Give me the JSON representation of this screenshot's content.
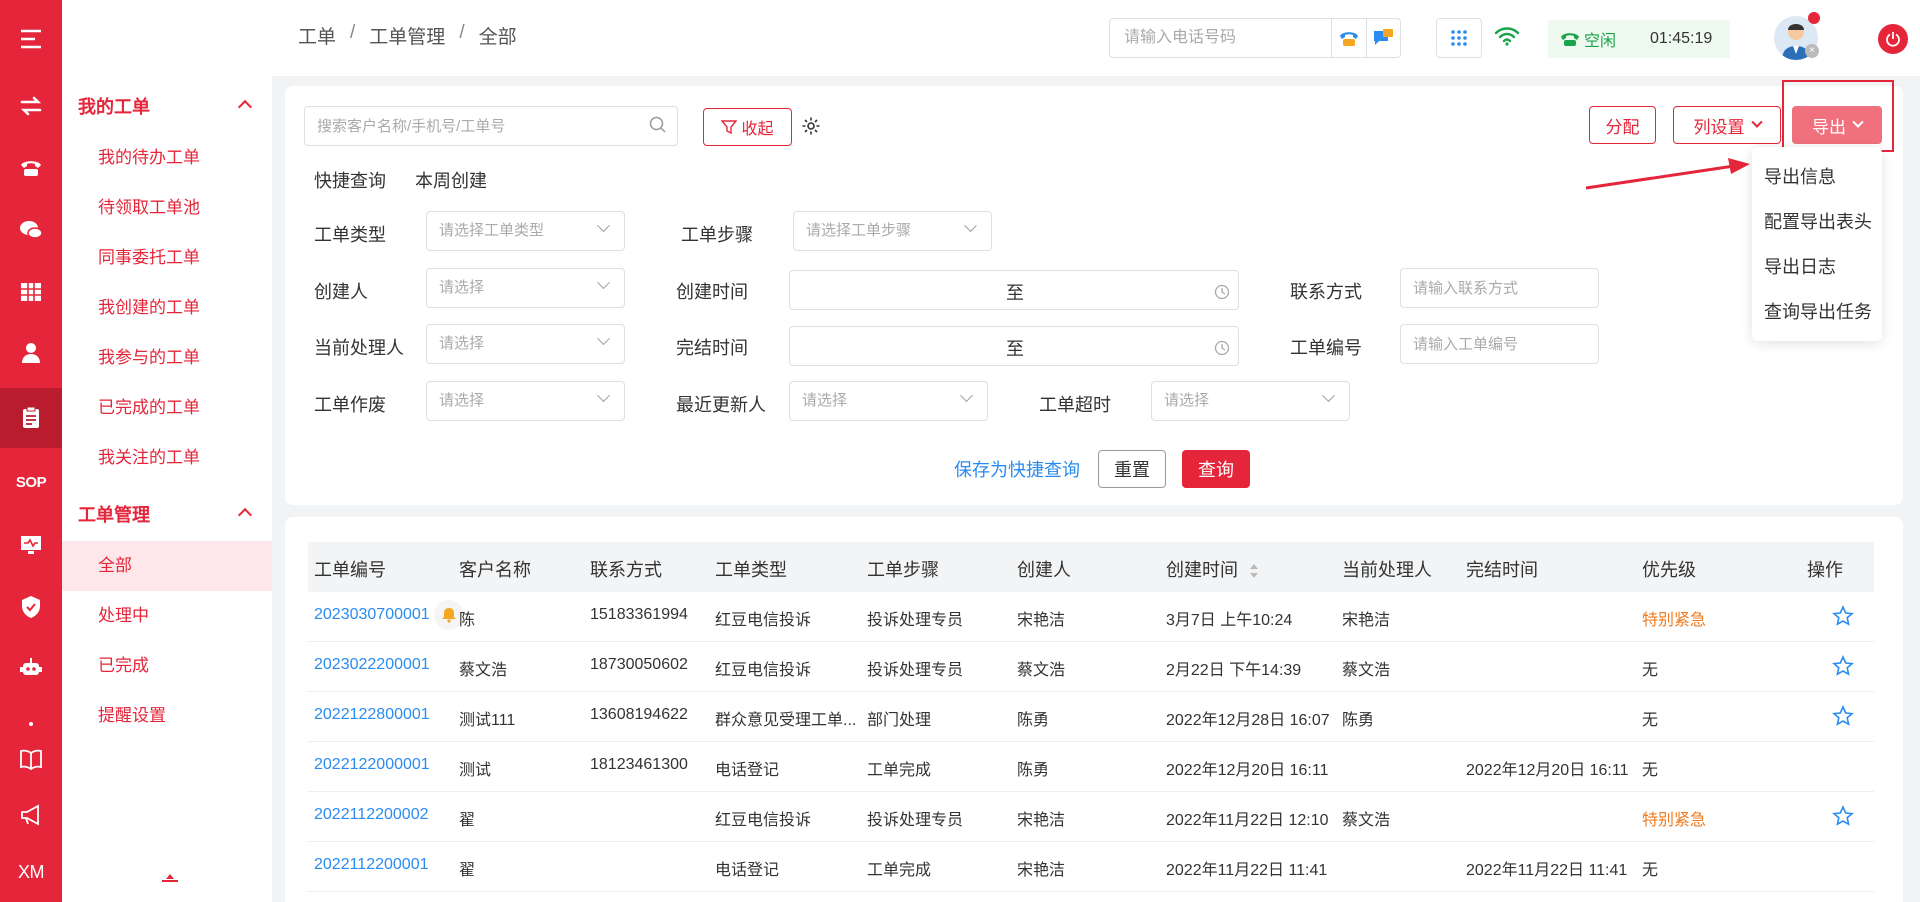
{
  "colors": {
    "brand": "#e5263a",
    "link": "#2a8cf0",
    "urgent": "#f07a1e",
    "status_green": "#1aa34a"
  },
  "rail": {
    "icons": [
      "menu-icon",
      "transfer-icon",
      "phone-icon",
      "chat-icon",
      "grid-icon",
      "user-icon",
      "clipboard-icon",
      "sop-label",
      "monitor-icon",
      "shield-icon",
      "robot-icon",
      "dot-icon",
      "book-icon",
      "megaphone-icon",
      "xm-label"
    ],
    "sop": "SOP",
    "xm": "XM"
  },
  "sidebar": {
    "group1": {
      "title": "我的工单",
      "items": [
        "我的待办工单",
        "待领取工单池",
        "同事委托工单",
        "我创建的工单",
        "我参与的工单",
        "已完成的工单",
        "我关注的工单"
      ]
    },
    "group2": {
      "title": "工单管理",
      "items": [
        "全部",
        "处理中",
        "已完成",
        "提醒设置"
      ]
    }
  },
  "header": {
    "breadcrumb": [
      "工单",
      "工单管理",
      "全部"
    ],
    "phone_placeholder": "请输入电话号码",
    "status": "空闲",
    "time": "01:45:19"
  },
  "filters": {
    "search_placeholder": "搜索客户名称/手机号/工单号",
    "collapse_label": "收起",
    "assign_label": "分配",
    "columns_label": "列设置",
    "export_label": "导出",
    "quick_query_label": "快捷查询",
    "quick_query_value": "本周创建",
    "type_label": "工单类型",
    "type_placeholder": "请选择工单类型",
    "step_label": "工单步骤",
    "step_placeholder": "请选择工单步骤",
    "creator_label": "创建人",
    "creator_placeholder": "请选择",
    "create_time_label": "创建时间",
    "range_sep": "至",
    "contact_label": "联系方式",
    "contact_placeholder": "请输入联系方式",
    "handler_label": "当前处理人",
    "handler_placeholder": "请选择",
    "finish_time_label": "完结时间",
    "number_label": "工单编号",
    "number_placeholder": "请输入工单编号",
    "void_label": "工单作废",
    "void_placeholder": "请选择",
    "updater_label": "最近更新人",
    "updater_placeholder": "请选择",
    "timeout_label": "工单超时",
    "timeout_placeholder": "请选择",
    "save_label": "保存为快捷查询",
    "reset_label": "重置",
    "query_label": "查询"
  },
  "export_menu": [
    "导出信息",
    "配置导出表头",
    "导出日志",
    "查询导出任务"
  ],
  "table": {
    "headers": [
      "工单编号",
      "客户名称",
      "联系方式",
      "工单类型",
      "工单步骤",
      "创建人",
      "创建时间",
      "当前处理人",
      "完结时间",
      "优先级",
      "操作"
    ],
    "rows": [
      [
        "2023030700001",
        "陈",
        "15183361994",
        "红豆电信投诉",
        "投诉处理专员",
        "宋艳洁",
        "3月7日 上午10:24",
        "宋艳洁",
        "",
        "特别紧急"
      ],
      [
        "2023022200001",
        "蔡文浩",
        "18730050602",
        "红豆电信投诉",
        "投诉处理专员",
        "蔡文浩",
        "2月22日 下午14:39",
        "蔡文浩",
        "",
        "无"
      ],
      [
        "2022122800001",
        "测试111",
        "13608194622",
        "群众意见受理工单...",
        "部门处理",
        "陈勇",
        "2022年12月28日 16:07",
        "陈勇",
        "",
        "无"
      ],
      [
        "2022122000001",
        "测试",
        "18123461300",
        "电话登记",
        "工单完成",
        "陈勇",
        "2022年12月20日 16:11",
        "",
        "2022年12月20日 16:11",
        "无"
      ],
      [
        "2022112200002",
        "翟",
        "",
        "红豆电信投诉",
        "投诉处理专员",
        "宋艳洁",
        "2022年11月22日 12:10",
        "蔡文浩",
        "",
        "特别紧急"
      ],
      [
        "2022112200001",
        "翟",
        "",
        "电话登记",
        "工单完成",
        "宋艳洁",
        "2022年11月22日 11:41",
        "",
        "2022年11月22日 11:41",
        "无"
      ]
    ]
  }
}
